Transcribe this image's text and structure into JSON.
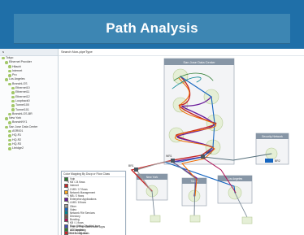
{
  "banner": {
    "title": "Path Analysis"
  },
  "header": {
    "search": "Search  Non-pipeType"
  },
  "tree": {
    "title": "s",
    "items": [
      {
        "label": "Tokyo",
        "color": "#a3c86a",
        "indent": 0
      },
      {
        "label": "Ethernet Provider",
        "color": "#a3c86a",
        "indent": 1
      },
      {
        "label": "Hitachi",
        "color": "#a3c86a",
        "indent": 2
      },
      {
        "label": "Internet",
        "color": "#a3c86a",
        "indent": 2
      },
      {
        "label": "Pro",
        "color": "#a3c86a",
        "indent": 2
      },
      {
        "label": "Los Angeles",
        "color": "#a3c86a",
        "indent": 1
      },
      {
        "label": "BranchLOS",
        "color": "#a3c86a",
        "indent": 2
      },
      {
        "label": "Ethernet10",
        "color": "#a3c86a",
        "indent": 3
      },
      {
        "label": "Ethernet11",
        "color": "#a3c86a",
        "indent": 3
      },
      {
        "label": "Ethernet12",
        "color": "#a3c86a",
        "indent": 3
      },
      {
        "label": "Loopback0",
        "color": "#a3c86a",
        "indent": 3
      },
      {
        "label": "Tunnel100",
        "color": "#a3c86a",
        "indent": 3
      },
      {
        "label": "Tunnel101",
        "color": "#a3c86a",
        "indent": 3
      },
      {
        "label": "BranchLOS-BR",
        "color": "#a3c86a",
        "indent": 2
      },
      {
        "label": "New York",
        "color": "#a3c86a",
        "indent": 1
      },
      {
        "label": "BranchNY1",
        "color": "#a3c86a",
        "indent": 2
      },
      {
        "label": "San Jose Data Center",
        "color": "#a3c86a",
        "indent": 1
      },
      {
        "label": "ASR001",
        "color": "#a3c86a",
        "indent": 2
      },
      {
        "label": "HQ-R1",
        "color": "#a3c86a",
        "indent": 2
      },
      {
        "label": "HQ-R2",
        "color": "#a3c86a",
        "indent": 2
      },
      {
        "label": "HQ-R3",
        "color": "#a3c86a",
        "indent": 2
      },
      {
        "label": "Lbridge2",
        "color": "#a3c86a",
        "indent": 2
      }
    ]
  },
  "legend": {
    "title": "Color Mapping By Dscp or Flow Class",
    "rows": [
      {
        "label": "Voip",
        "color": "#2e7d32",
        "sub": false
      },
      {
        "label": "*5 KB / 24 flows",
        "color": "",
        "sub": true
      },
      {
        "label": "Internet",
        "color": "#c62828",
        "sub": false
      },
      {
        "label": "*3.2 MB / 17 flows",
        "color": "",
        "sub": true
      },
      {
        "label": "Network Management",
        "color": "#f9a825",
        "sub": false
      },
      {
        "label": "*0 MB / 2 flows",
        "color": "",
        "sub": true
      },
      {
        "label": "Enterprise Applications",
        "color": "#6a1b9a",
        "sub": false
      },
      {
        "label": "*5.4 MB / 8 flows",
        "color": "",
        "sub": true
      },
      {
        "label": "Other",
        "color": "#9e9e9e",
        "sub": false
      },
      {
        "label": "Video",
        "color": "#1565c0",
        "sub": false
      },
      {
        "label": "Network Filé Services",
        "color": "#00838f",
        "sub": false
      },
      {
        "label": "Directory",
        "color": "#795548",
        "sub": false
      },
      {
        "label": "Bonding",
        "color": "#ad1457",
        "sub": false
      },
      {
        "label": "*0 KB / 1 flows",
        "color": "",
        "sub": true
      },
      {
        "label": "Peer to Peer Bannerable Apps",
        "color": "#ef6c00",
        "sub": false
      },
      {
        "label": "All Remaining",
        "color": "#546e7a",
        "sub": false
      },
      {
        "label": "*367 KB / 101 flows",
        "color": "",
        "sub": true
      }
    ],
    "footer": [
      {
        "label": "Flow Hiding Disabled icon",
        "color": "#3f51b5"
      },
      {
        "label": "ACL Applied",
        "color": "#2e7d32"
      },
      {
        "label": "Not Configured",
        "color": "#c62828"
      }
    ]
  },
  "topology": {
    "sites": [
      {
        "name": "San Jose Data Center"
      },
      {
        "name": "Security Network"
      },
      {
        "name": "New York"
      },
      {
        "name": "Los Angeles"
      },
      {
        "name": "Tokyo"
      }
    ],
    "routers": [
      {
        "name": "WR1"
      },
      {
        "name": "WR2"
      },
      {
        "name": "BR1"
      },
      {
        "name": "BR2"
      }
    ]
  }
}
